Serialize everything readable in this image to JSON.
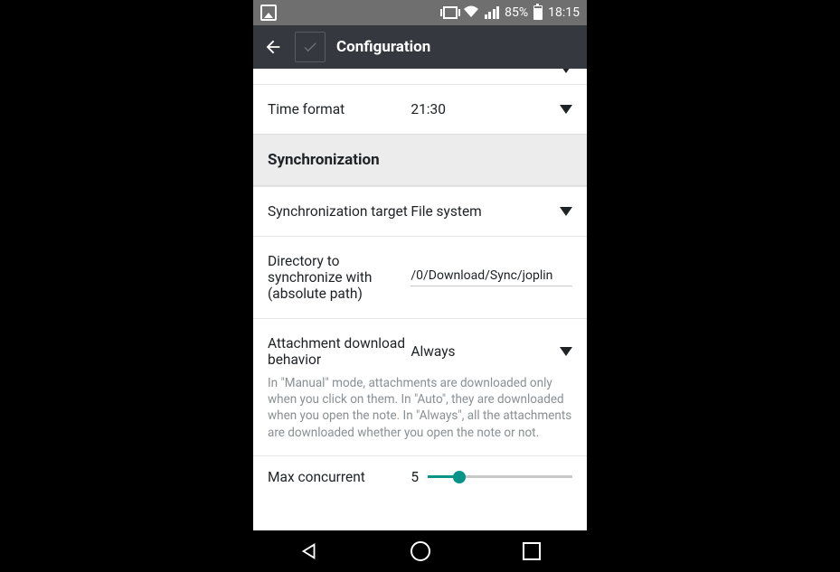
{
  "statusbar": {
    "battery_pct": "85%",
    "time": "18:15"
  },
  "appbar": {
    "title": "Configuration"
  },
  "settings": {
    "time_format": {
      "label": "Time format",
      "value": "21:30"
    },
    "section_sync": "Synchronization",
    "sync_target": {
      "label": "Synchronization target",
      "value": "File system"
    },
    "sync_dir": {
      "label": "Directory to synchronize with (absolute path)",
      "value": "/0/Download/Sync/joplin"
    },
    "attach": {
      "label": "Attachment download behavior",
      "value": "Always",
      "desc": "In \"Manual\" mode, attachments are downloaded only when you click on them. In \"Auto\", they are downloaded when you open the note. In \"Always\", all the attachments are downloaded whether you open the note or not."
    },
    "max_conc": {
      "label": "Max concurrent",
      "value": "5"
    }
  }
}
